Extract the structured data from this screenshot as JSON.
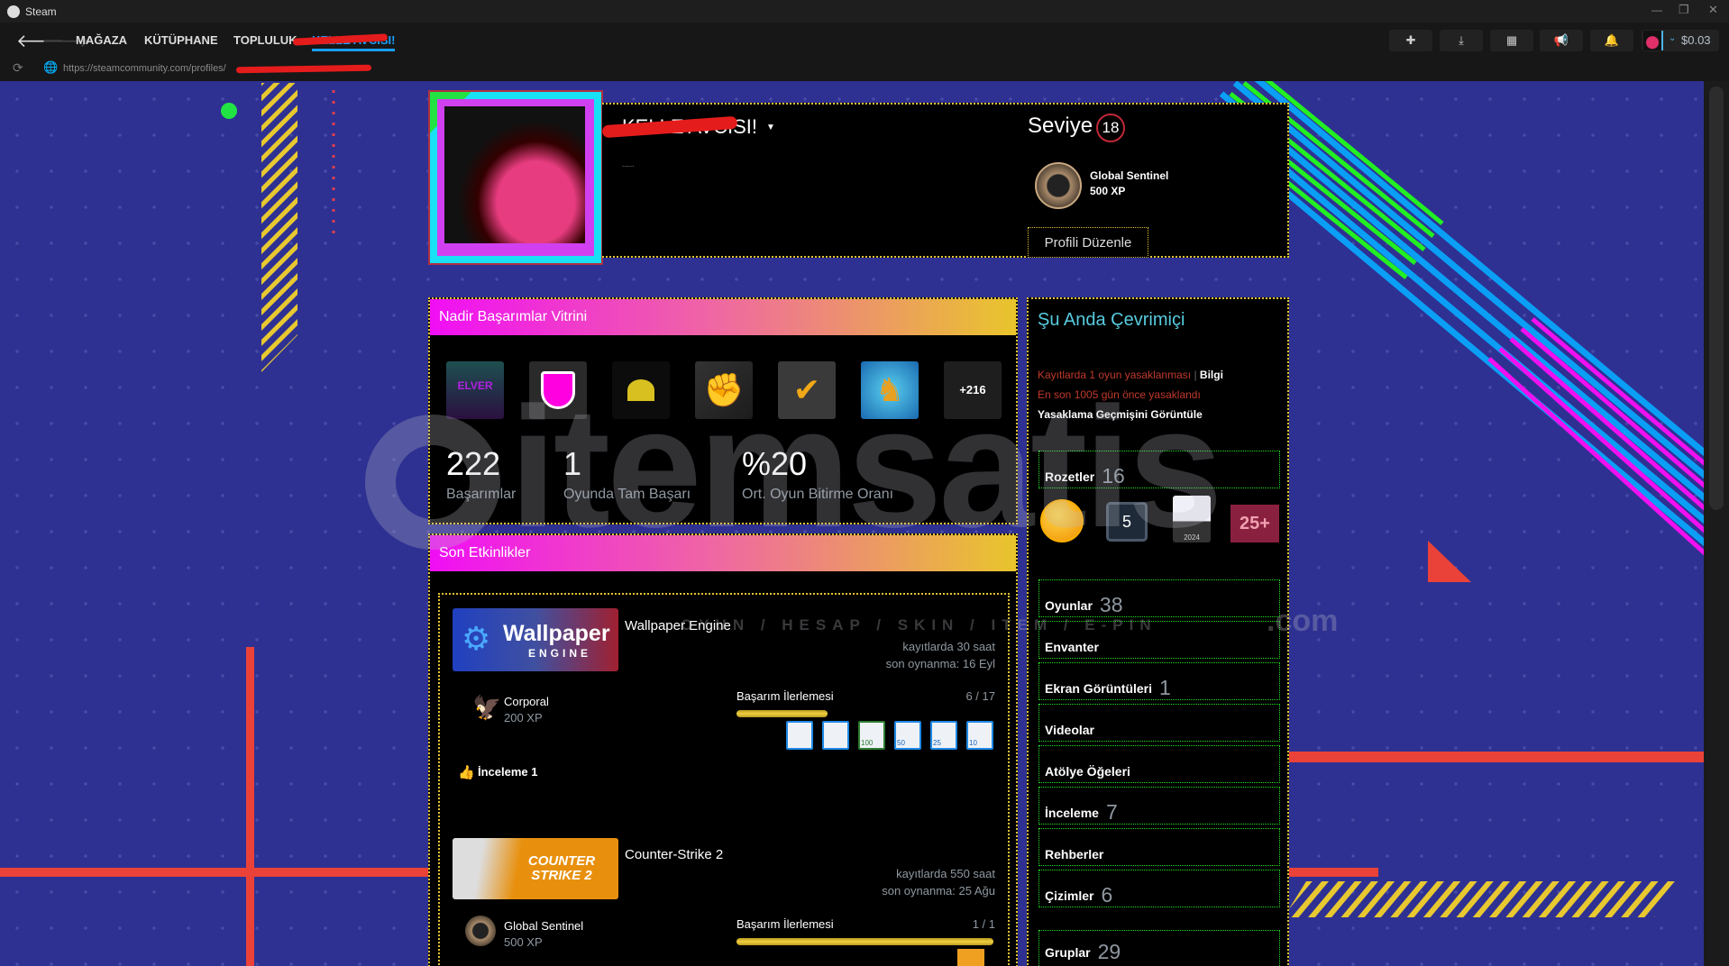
{
  "window": {
    "title": "Steam",
    "minimize": "—",
    "restore": "❐",
    "close": "✕"
  },
  "nav": {
    "links": [
      "MAĞAZA",
      "KÜTÜPHANE",
      "TOPLULUK",
      "KELLE AVCISI!"
    ],
    "wallet": "$0.03"
  },
  "url": "https://steamcommunity.com/profiles/",
  "profile": {
    "name": "KELLE AVCISI!",
    "summary": "......",
    "level_label": "Seviye",
    "level": "18",
    "badge_name": "Global Sentinel",
    "badge_xp": "500 XP",
    "edit_button": "Profili Düzenle"
  },
  "showcase": {
    "title": "Nadir Başarımlar Vitrini",
    "more": "+216",
    "stats": [
      {
        "value": "222",
        "label": "Başarımlar"
      },
      {
        "value": "1",
        "label": "Oyunda Tam Başarı"
      },
      {
        "value": "%20",
        "label": "Ort. Oyun Bitirme Oranı"
      }
    ]
  },
  "activity": {
    "title": "Son Etkinlikler",
    "games": [
      {
        "name": "Wallpaper Engine",
        "capsule_text": "Wallpaper",
        "capsule_sub": "ENGINE",
        "hours": "kayıtlarda 30 saat",
        "last_played": "son oynanma: 16 Eyl",
        "badge_name": "Corporal",
        "badge_xp": "200 XP",
        "progress_label": "Başarım İlerlemesi",
        "progress": "6 / 17",
        "progress_fraction": 0.353,
        "ach_icons": [
          "",
          "",
          "100",
          "50",
          "25",
          "10"
        ],
        "review": "İnceleme 1"
      },
      {
        "name": "Counter-Strike 2",
        "capsule_text": "COUNTER STRIKE 2",
        "hours": "kayıtlarda 550 saat",
        "last_played": "son oynanma: 25 Ağu",
        "badge_name": "Global Sentinel",
        "badge_xp": "500 XP",
        "progress_label": "Başarım İlerlemesi",
        "progress": "1 / 1",
        "progress_fraction": 1.0
      }
    ]
  },
  "side": {
    "status": "Şu Anda Çevrimiçi",
    "ban1": "Kayıtlarda 1 oyun yasaklanması",
    "ban_sep": "|",
    "ban_info": "Bilgi",
    "ban2": "En son 1005 gün önce yasaklandı",
    "ban_history": "Yasaklama Geçmişini Görüntüle",
    "badges_label": "Rozetler",
    "badges_count": "16",
    "badge_icons": [
      "",
      "5",
      "2024",
      "25+"
    ],
    "links": [
      {
        "label": "Oyunlar",
        "count": "38"
      },
      {
        "label": "Envanter",
        "count": ""
      },
      {
        "label": "Ekran Görüntüleri",
        "count": "1"
      },
      {
        "label": "Videolar",
        "count": ""
      },
      {
        "label": "Atölye Öğeleri",
        "count": ""
      },
      {
        "label": "İnceleme",
        "count": "7"
      },
      {
        "label": "Rehberler",
        "count": ""
      },
      {
        "label": "Çizimler",
        "count": "6"
      }
    ],
    "groups_label": "Gruplar",
    "groups_count": "29"
  },
  "watermark": {
    "brand": "itemsatis",
    "tagline": "OYUN / HESAP / SKIN / ITEM / E-PIN",
    "tld": ".com"
  },
  "colors": {
    "bg": "#2e3192",
    "accent": "#1a9fff",
    "ban": "#c0392b",
    "online": "#57cbde"
  }
}
